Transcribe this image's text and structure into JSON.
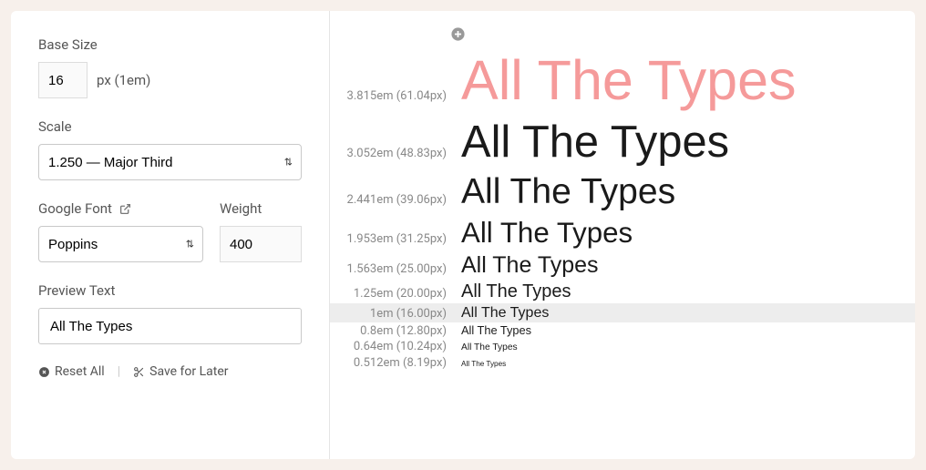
{
  "sidebar": {
    "base_size_label": "Base Size",
    "base_size_value": "16",
    "base_size_unit": "px (1em)",
    "scale_label": "Scale",
    "scale_value": "1.250 — Major Third",
    "font_label": "Google Font",
    "font_value": "Poppins",
    "weight_label": "Weight",
    "weight_value": "400",
    "preview_label": "Preview Text",
    "preview_value": "All The Types",
    "reset_label": "Reset All",
    "save_label": "Save for Later"
  },
  "scale_rows": [
    {
      "em": "3.815em",
      "px": "(61.04px)",
      "size": 61.04,
      "accent": true,
      "highlight": false
    },
    {
      "em": "3.052em",
      "px": "(48.83px)",
      "size": 48.83,
      "accent": false,
      "highlight": false
    },
    {
      "em": "2.441em",
      "px": "(39.06px)",
      "size": 39.06,
      "accent": false,
      "highlight": false
    },
    {
      "em": "1.953em",
      "px": "(31.25px)",
      "size": 31.25,
      "accent": false,
      "highlight": false
    },
    {
      "em": "1.563em",
      "px": "(25.00px)",
      "size": 25.0,
      "accent": false,
      "highlight": false
    },
    {
      "em": "1.25em",
      "px": "(20.00px)",
      "size": 20.0,
      "accent": false,
      "highlight": false
    },
    {
      "em": "1em",
      "px": "(16.00px)",
      "size": 16.0,
      "accent": false,
      "highlight": true
    },
    {
      "em": "0.8em",
      "px": "(12.80px)",
      "size": 12.8,
      "accent": false,
      "highlight": false
    },
    {
      "em": "0.64em",
      "px": "(10.24px)",
      "size": 10.24,
      "accent": false,
      "highlight": false
    },
    {
      "em": "0.512em",
      "px": "(8.19px)",
      "size": 8.19,
      "accent": false,
      "highlight": false
    }
  ],
  "preview_text": "All The Types",
  "colors": {
    "accent": "#f59a9a"
  }
}
